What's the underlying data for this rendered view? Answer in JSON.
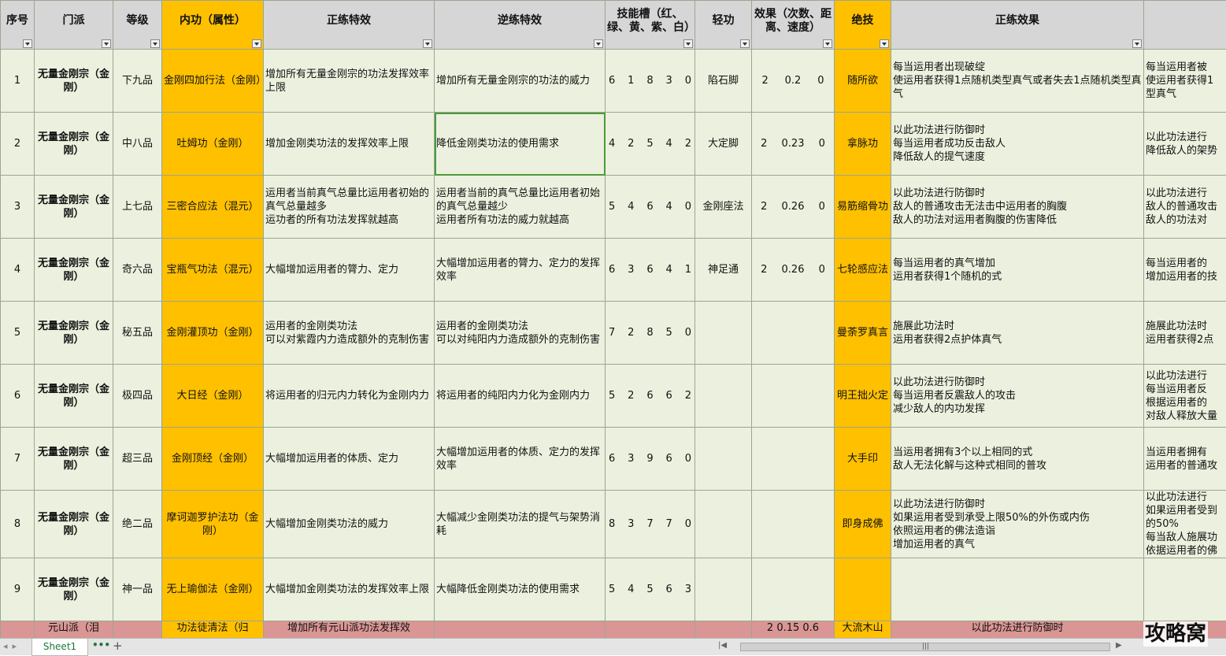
{
  "sheet_tab": "Sheet1",
  "watermark": "攻略窝",
  "headers": [
    "序号",
    "门派",
    "等级",
    "内功（属性）",
    "正练特效",
    "逆练特效",
    "技能槽（红、绿、黄、紫、白）",
    "轻功",
    "效果（次数、距离、速度）",
    "绝技",
    "正练效果",
    ""
  ],
  "rows": [
    {
      "no": "1",
      "sect": "无量金刚宗（金刚）",
      "grade": "下九品",
      "neigong": "金刚四加行法（金刚）",
      "zheng": "增加所有无量金刚宗的功法发挥效率上限",
      "ni": "增加所有无量金刚宗的功法的威力",
      "slots": [
        "6",
        "1",
        "8",
        "3",
        "0"
      ],
      "qinggong": "陷石脚",
      "effect": [
        "2",
        "0.2",
        "0"
      ],
      "jueji": "随所欲",
      "zheng_effect": "每当运用者出现破绽\n使运用者获得1点随机类型真气或者失去1点随机类型真气",
      "ni_effect": "每当运用者被\n使运用者获得1\n型真气"
    },
    {
      "no": "2",
      "sect": "无量金刚宗（金刚）",
      "grade": "中八品",
      "neigong": "吐姆功（金刚）",
      "zheng": "增加金刚类功法的发挥效率上限",
      "ni": "降低金刚类功法的使用需求",
      "slots": [
        "4",
        "2",
        "5",
        "4",
        "2"
      ],
      "qinggong": "大定脚",
      "effect": [
        "2",
        "0.23",
        "0"
      ],
      "jueji": "拿脉功",
      "zheng_effect": "以此功法进行防御时\n每当运用者成功反击敌人\n降低敌人的提气速度",
      "ni_effect": "以此功法进行\n降低敌人的架势"
    },
    {
      "no": "3",
      "sect": "无量金刚宗（金刚）",
      "grade": "上七品",
      "neigong": "三密合应法（混元）",
      "zheng": "运用者当前真气总量比运用者初始的真气总量越多\n运功者的所有功法发挥就越高",
      "ni": "运用者当前的真气总量比运用者初始的真气总量越少\n运用者所有功法的威力就越高",
      "slots": [
        "5",
        "4",
        "6",
        "4",
        "0"
      ],
      "qinggong": "金刚座法",
      "effect": [
        "2",
        "0.26",
        "0"
      ],
      "jueji": "易筋缩骨功",
      "zheng_effect": "以此功法进行防御时\n敌人的普通攻击无法击中运用者的胸腹\n敌人的功法对运用者胸腹的伤害降低",
      "ni_effect": "以此功法进行\n敌人的普通攻击\n敌人的功法对"
    },
    {
      "no": "4",
      "sect": "无量金刚宗（金刚）",
      "grade": "奇六品",
      "neigong": "宝瓶气功法（混元）",
      "zheng": "大幅增加运用者的膂力、定力",
      "ni": "大幅增加运用者的膂力、定力的发挥效率",
      "slots": [
        "6",
        "3",
        "6",
        "4",
        "1"
      ],
      "qinggong": "神足通",
      "effect": [
        "2",
        "0.26",
        "0"
      ],
      "jueji": "七轮感应法",
      "zheng_effect": "每当运用者的真气增加\n运用者获得1个随机的式",
      "ni_effect": "每当运用者的\n增加运用者的技"
    },
    {
      "no": "5",
      "sect": "无量金刚宗（金刚）",
      "grade": "秘五品",
      "neigong": "金刚灌顶功（金刚）",
      "zheng": "运用者的金刚类功法\n可以对紫霞内力造成额外的克制伤害",
      "ni": "运用者的金刚类功法\n可以对纯阳内力造成额外的克制伤害",
      "slots": [
        "7",
        "2",
        "8",
        "5",
        "0"
      ],
      "qinggong": "",
      "effect": [
        "",
        "",
        ""
      ],
      "jueji": "曼荼罗真言",
      "zheng_effect": "施展此功法时\n运用者获得2点护体真气",
      "ni_effect": "施展此功法时\n运用者获得2点"
    },
    {
      "no": "6",
      "sect": "无量金刚宗（金刚）",
      "grade": "极四品",
      "neigong": "大日经（金刚）",
      "zheng": "将运用者的归元内力转化为金刚内力",
      "ni": "将运用者的纯阳内力化为金刚内力",
      "slots": [
        "5",
        "2",
        "6",
        "6",
        "2"
      ],
      "qinggong": "",
      "effect": [
        "",
        "",
        ""
      ],
      "jueji": "明王拙火定",
      "zheng_effect": "以此功法进行防御时\n每当运用者反震敌人的攻击\n减少敌人的内功发挥",
      "ni_effect": "以此功法进行\n每当运用者反\n根据运用者的\n对敌人释放大量"
    },
    {
      "no": "7",
      "sect": "无量金刚宗（金刚）",
      "grade": "超三品",
      "neigong": "金刚顶经（金刚）",
      "zheng": "大幅增加运用者的体质、定力",
      "ni": "大幅增加运用者的体质、定力的发挥效率",
      "slots": [
        "6",
        "3",
        "9",
        "6",
        "0"
      ],
      "qinggong": "",
      "effect": [
        "",
        "",
        ""
      ],
      "jueji": "大手印",
      "zheng_effect": "当运用者拥有3个以上相同的式\n敌人无法化解与这种式相同的普攻",
      "ni_effect": "当运用者拥有\n运用者的普通攻"
    },
    {
      "no": "8",
      "sect": "无量金刚宗（金刚）",
      "grade": "绝二品",
      "neigong": "摩诃迦罗护法功（金刚）",
      "zheng": "大幅增加金刚类功法的威力",
      "ni": "大幅减少金刚类功法的提气与架势消耗",
      "slots": [
        "8",
        "3",
        "7",
        "7",
        "0"
      ],
      "qinggong": "",
      "effect": [
        "",
        "",
        ""
      ],
      "jueji": "即身成佛",
      "zheng_effect": "以此功法进行防御时\n如果运用者受到承受上限50%的外伤或内伤\n依照运用者的佛法造诣\n增加运用者的真气",
      "ni_effect": "以此功法进行\n如果运用者受到\n的50%\n每当敌人施展功\n依据运用者的佛"
    },
    {
      "no": "9",
      "sect": "无量金刚宗（金刚）",
      "grade": "神一品",
      "neigong": "无上瑜伽法（金刚）",
      "zheng": "大幅增加金刚类功法的发挥效率上限",
      "ni": "大幅降低金刚类功法的使用需求",
      "slots": [
        "5",
        "4",
        "5",
        "6",
        "3"
      ],
      "qinggong": "",
      "effect": [
        "",
        "",
        ""
      ],
      "jueji": "",
      "zheng_effect": "",
      "ni_effect": ""
    }
  ],
  "partial_row": {
    "sect": "元山派（泪",
    "neigong": "功法徒清法（归",
    "zheng": "增加所有元山派功法发挥效",
    "effect": "2  0.15  0.6",
    "jueji": "大流木山",
    "zheng_effect": "以此功法进行防御时"
  }
}
